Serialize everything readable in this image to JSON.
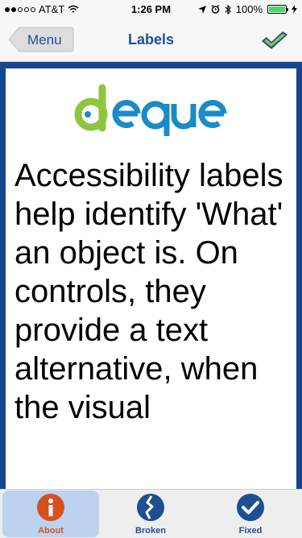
{
  "status_bar": {
    "carrier": "AT&T",
    "time": "1:26 PM",
    "battery_percent": "100%",
    "battery_level": 1.0
  },
  "nav": {
    "back_label": "Menu",
    "title": "Labels"
  },
  "logo": {
    "text": "deque"
  },
  "content": {
    "text": "Accessibility labels help identify 'What' an object is.  On controls, they provide a text alternative, when the visual"
  },
  "tabs": [
    {
      "label": "About",
      "icon": "info-icon",
      "selected": true
    },
    {
      "label": "Broken",
      "icon": "broken-icon",
      "selected": false
    },
    {
      "label": "Fixed",
      "icon": "checkmark-icon",
      "selected": false
    }
  ],
  "colors": {
    "nav_blue": "#1e4f91",
    "frame_blue": "#16468c",
    "about_orange": "#d35220",
    "logo_green": "#8dc63f",
    "logo_blue": "#1a8bc8",
    "selected_tab_bg": "#bdd2ef"
  }
}
